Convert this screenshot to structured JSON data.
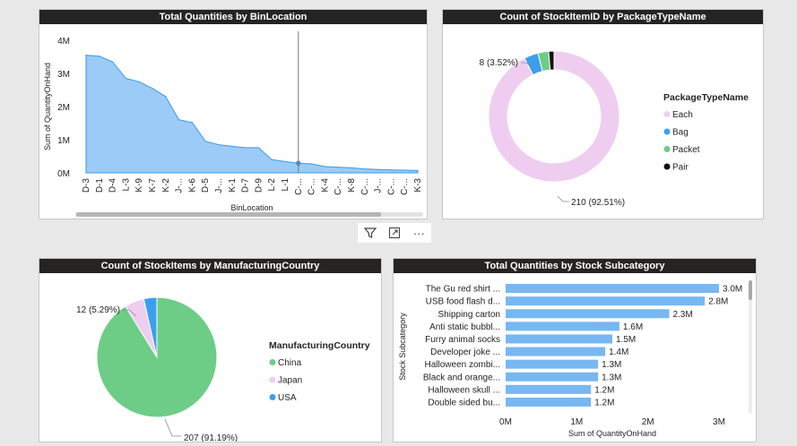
{
  "colors": {
    "bar_blue": "#77b7f2",
    "area_blue": "#9ccbf8",
    "line_blue": "#3a99e8",
    "pink": "#efcdf0",
    "green": "#6dcd86",
    "blue": "#3c9fee",
    "black": "#111111"
  },
  "visual_toolbar": {
    "filter_icon": "filter-icon",
    "focus_icon": "focus-mode-icon",
    "more_icon": "more-options-icon",
    "more_label": "···"
  },
  "chart_data": [
    {
      "type": "area",
      "title": "Total Quantities by BinLocation",
      "xlabel": "BinLocation",
      "ylabel": "Sum of QuantityOnHand",
      "yticks": [
        "4M",
        "3M",
        "2M",
        "1M",
        "0M"
      ],
      "ylim": [
        0,
        4000000
      ],
      "categories": [
        "D-3",
        "D-1",
        "D-4",
        "L-3",
        "K-9",
        "K-7",
        "K-2",
        "J-...",
        "K-6",
        "D-5",
        "J-...",
        "K-1",
        "D-7",
        "D-9",
        "L-2",
        "L-1",
        "C-...",
        "C-...",
        "K-4",
        "C-...",
        "K-8",
        "C-...",
        "J-...",
        "C-...",
        "C-...",
        "K-3"
      ],
      "values": [
        3550000,
        3520000,
        3350000,
        2850000,
        2750000,
        2550000,
        2300000,
        1600000,
        1520000,
        950000,
        850000,
        800000,
        760000,
        760000,
        400000,
        340000,
        290000,
        270000,
        190000,
        170000,
        150000,
        120000,
        100000,
        90000,
        80000,
        70000
      ],
      "highlight_index": 16
    },
    {
      "type": "pie",
      "donut": true,
      "title": "Count of StockItemID by PackageTypeName",
      "legend_title": "PackageTypeName",
      "labels": [
        "Each",
        "Bag",
        "Packet",
        "Pair"
      ],
      "values": [
        210,
        8,
        6,
        3
      ],
      "data_labels": [
        "210 (92.51%)",
        "8 (3.52%)"
      ]
    },
    {
      "type": "pie",
      "title": "Count of StockItems by ManufacturingCountry",
      "legend_title": "ManufacturingCountry",
      "labels": [
        "China",
        "Japan",
        "USA"
      ],
      "values": [
        207,
        12,
        8
      ],
      "data_labels": [
        "207 (91.19%)",
        "12 (5.29%)"
      ]
    },
    {
      "type": "bar",
      "orientation": "horizontal",
      "title": "Total Quantities by Stock Subcategory",
      "xlabel": "Sum of QuantityOnHand",
      "ylabel": "Stock Subcategory",
      "xticks": [
        "0M",
        "1M",
        "2M",
        "3M"
      ],
      "xlim": [
        0,
        3000000
      ],
      "categories": [
        "The Gu red shirt ...",
        "USB food flash d...",
        "Shipping carton",
        "Anti static bubbl...",
        "Furry animal socks",
        "Developer joke ...",
        "Halloween zombi...",
        "Black and orange...",
        "Halloween skull ...",
        "Double sided bu..."
      ],
      "values": [
        3000000,
        2800000,
        2300000,
        1600000,
        1500000,
        1400000,
        1300000,
        1300000,
        1200000,
        1200000
      ],
      "data_labels": [
        "3.0M",
        "2.8M",
        "2.3M",
        "1.6M",
        "1.5M",
        "1.4M",
        "1.3M",
        "1.3M",
        "1.2M",
        "1.2M"
      ]
    }
  ]
}
